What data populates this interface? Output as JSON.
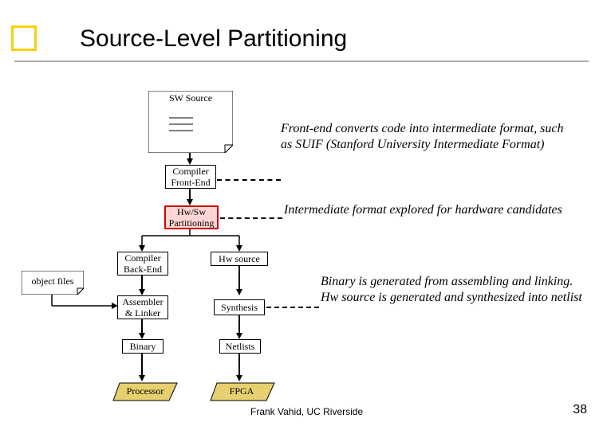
{
  "title": "Source-Level Partitioning",
  "boxes": {
    "sw_source": "SW Source",
    "compiler_fe": "Compiler Front-End",
    "hwsw_part": "Hw/Sw Partitioning",
    "compiler_be": "Compiler Back-End",
    "hw_source": "Hw source",
    "asm_link": "Assembler & Linker",
    "synthesis": "Synthesis",
    "binary": "Binary",
    "netlists": "Netlists",
    "processor": "Processor",
    "fpga": "FPGA",
    "object_files": "object files"
  },
  "annotations": {
    "a1": "Front-end converts code into intermediate format, such as SUIF (Stanford University Intermediate Format)",
    "a2": "Intermediate format explored for hardware candidates",
    "a3": "Binary is generated from assembling and linking.  Hw source is generated and synthesized into netlist"
  },
  "footer": {
    "author": "Frank Vahid, UC Riverside",
    "page": "38"
  }
}
